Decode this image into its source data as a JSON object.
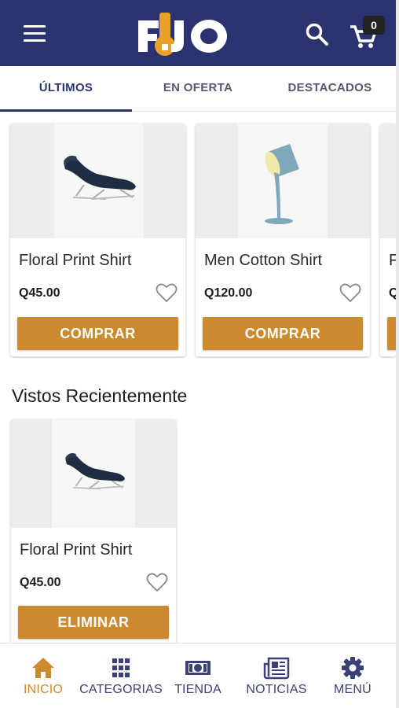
{
  "header": {
    "logo_text": "FIJO",
    "cart_count": "0",
    "accent_color": "#2b3270",
    "logo_accent": "#e8a227"
  },
  "tabs": [
    {
      "label": "ÚLTIMOS",
      "active": true
    },
    {
      "label": "EN OFERTA",
      "active": false
    },
    {
      "label": "DESTACADOS",
      "active": false
    }
  ],
  "latest_products": [
    {
      "title": "Floral Print Shirt",
      "price": "Q45.00",
      "button": "COMPRAR",
      "image": "lounge-chair"
    },
    {
      "title": "Men Cotton Shirt",
      "price": "Q120.00",
      "button": "COMPRAR",
      "image": "pouring-lamp"
    },
    {
      "title": "F",
      "price": "Q",
      "button": "",
      "image": "partial"
    }
  ],
  "recently_viewed": {
    "title": "Vistos Recientemente",
    "items": [
      {
        "title": "Floral Print Shirt",
        "price": "Q45.00",
        "button": "ELIMINAR",
        "image": "lounge-chair"
      }
    ]
  },
  "bottom_nav": [
    {
      "label": "INICIO",
      "icon": "home-icon",
      "active": true
    },
    {
      "label": "CATEGORIAS",
      "icon": "grid-icon",
      "active": false
    },
    {
      "label": "TIENDA",
      "icon": "money-icon",
      "active": false
    },
    {
      "label": "NOTICIAS",
      "icon": "newspaper-icon",
      "active": false
    },
    {
      "label": "MENÚ",
      "icon": "gear-icon",
      "active": false
    }
  ],
  "colors": {
    "button": "#cc8a2e",
    "nav_active": "#cc8a2e",
    "nav_inactive": "#3b4176"
  }
}
